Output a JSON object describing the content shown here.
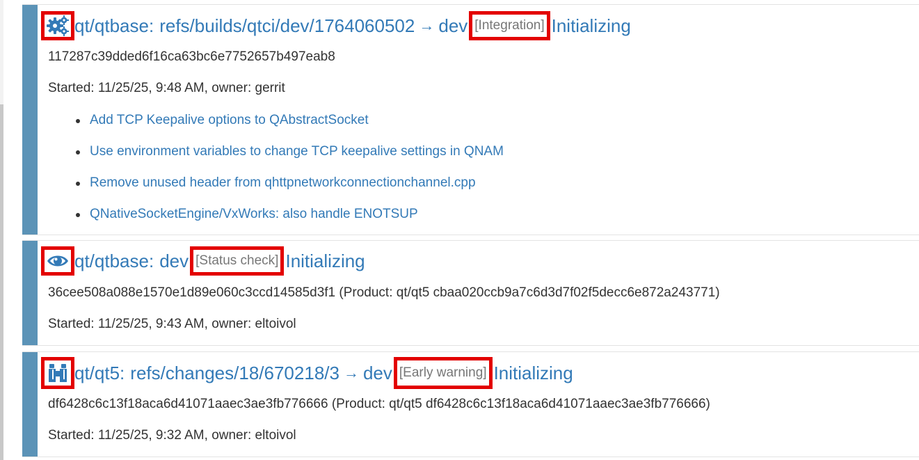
{
  "colors": {
    "accent": "#337ab7",
    "stripe": "#5b93b7",
    "highlight": "#e30000",
    "badge_text": "#777777"
  },
  "cards": [
    {
      "icon": "gears-icon",
      "project": "qt/qtbase:",
      "ref": "refs/builds/qtci/dev/1764060502",
      "arrow": "→",
      "target": "dev",
      "badge": "[Integration]",
      "status": "Initializing",
      "sha_line": "117287c39dded6f16ca63bc6e7752657b497eab8",
      "started": "Started: 11/25/25, 9:48 AM, owner: gerrit",
      "changes": [
        "Add TCP Keepalive options to QAbstractSocket",
        "Use environment variables to change TCP keepalive settings in QNAM",
        "Remove unused header from qhttpnetworkconnectionchannel.cpp",
        "QNativeSocketEngine/VxWorks: also handle ENOTSUP"
      ]
    },
    {
      "icon": "eye-icon",
      "project": "qt/qtbase:",
      "ref": "dev",
      "badge": "[Status check]",
      "status": "Initializing",
      "sha_line": "36cee508a088e1570e1d89e060c3ccd14585d3f1 (Product: qt/qt5 cbaa020ccb9a7c6d3d7f02f5decc6e872a243771)",
      "started": "Started: 11/25/25, 9:43 AM, owner: eltoivol"
    },
    {
      "icon": "binoculars-icon",
      "project": "qt/qt5:",
      "ref": "refs/changes/18/670218/3",
      "arrow": "→",
      "target": "dev",
      "badge": "[Early warning]",
      "status": "Initializing",
      "sha_line": "df6428c6c13f18aca6d41071aaec3ae3fb776666 (Product: qt/qt5 df6428c6c13f18aca6d41071aaec3ae3fb776666)",
      "started": "Started: 11/25/25, 9:32 AM, owner: eltoivol"
    }
  ]
}
